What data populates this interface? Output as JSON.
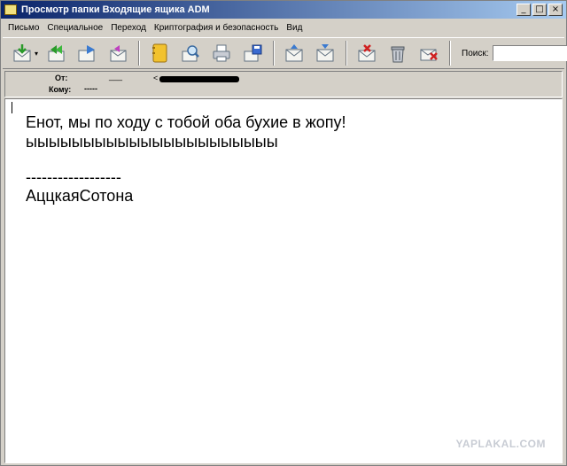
{
  "window": {
    "title": "Просмотр папки Входящие ящика ADM",
    "buttons": {
      "minimize": "_",
      "maximize": "□",
      "close": "×"
    }
  },
  "menu": {
    "items": [
      "Письмо",
      "Специальное",
      "Переход",
      "Криптография и безопасность",
      "Вид"
    ]
  },
  "toolbar": {
    "search_label": "Поиск:",
    "search_value": "",
    "dropdown_glyph": "▾",
    "tools": [
      "mail-get-icon",
      "reply-all-icon",
      "forward-icon",
      "reply-icon",
      "address-book-icon",
      "find-icon",
      "print-icon",
      "save-icon",
      "previous-message-icon",
      "next-message-icon",
      "delete-mark-icon",
      "trash-icon",
      "junk-icon"
    ]
  },
  "header": {
    "from_label": "От:",
    "from_name": "___",
    "from_address_prefix": "<",
    "to_label": "Кому:",
    "to_value": "-----"
  },
  "message": {
    "line1": "Енот, мы по ходу с тобой оба бухие в жопу!",
    "line2": "ыыыыыыыыыыыыыыыыыыыыыы",
    "line3": "------------------",
    "line4": "АццкаяСотона"
  },
  "watermark": "YAPLAKAL.COM",
  "colors": {
    "titlebar_start": "#0a246a",
    "titlebar_end": "#a6caf0",
    "chrome": "#d4d0c8",
    "body": "#ffffff"
  }
}
